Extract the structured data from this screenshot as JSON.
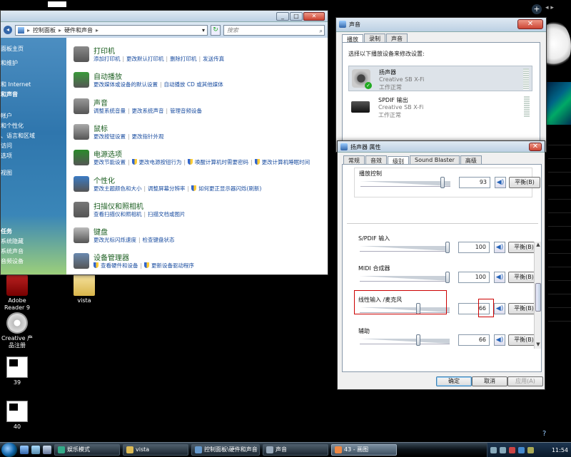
{
  "desktop": {
    "icons": [
      {
        "label": "Adobe Reader 9",
        "kind": "pdf"
      },
      {
        "label": "vista",
        "kind": "folder"
      },
      {
        "label": "Creative 产品注册",
        "kind": "cd"
      },
      {
        "label": "39",
        "kind": "thumb"
      },
      {
        "label": "40",
        "kind": "thumb"
      }
    ],
    "sidebar_feed": [
      "",
      "",
      "",
      "",
      ""
    ]
  },
  "control_panel": {
    "breadcrumb": [
      "控制面板",
      "硬件和声音"
    ],
    "search_placeholder": "搜索",
    "sidebar": [
      "面板主页",
      "和维护",
      "和 Internet",
      "和声音",
      "帐户",
      "和个性化",
      "、语言和区域",
      "访问",
      "选项",
      "视图",
      "任务",
      "系统隐藏",
      "系统声音",
      "音频设备"
    ],
    "categories": [
      {
        "title": "打印机",
        "links": [
          "添加打印机",
          "更改默认打印机",
          "删除打印机",
          "发送传真"
        ],
        "color": "#8a8a8a"
      },
      {
        "title": "自动播放",
        "links": [
          "更改媒体或设备的默认设置",
          "自动播放 CD 或其他媒体"
        ],
        "color": "#3a9a3a"
      },
      {
        "title": "声音",
        "links": [
          "调整系统音量",
          "更改系统声音",
          "管理音频设备"
        ],
        "color": "#999"
      },
      {
        "title": "鼠标",
        "links": [
          "更改按钮设置",
          "更改指针外观"
        ],
        "color": "#aaa"
      },
      {
        "title": "电源选项",
        "links": [
          "更改节能设置",
          "更改电源按钮行为",
          "唤醒计算机时需要密码",
          "更改计算机睡眠时间"
        ],
        "color": "#2a8a2a"
      },
      {
        "title": "个性化",
        "links": [
          "更改主题颜色和大小",
          "调整屏幕分辨率",
          "如何更正显示器闪烁(刷新)"
        ],
        "color": "#3b7bc4"
      },
      {
        "title": "扫描仪和照相机",
        "links": [
          "查看扫描仪和照相机",
          "扫描文档或图片"
        ],
        "color": "#777"
      },
      {
        "title": "键盘",
        "links": [
          "更改光标闪烁速度",
          "检查键盘状态"
        ],
        "color": "#bbb"
      },
      {
        "title": "设备管理器",
        "links": [
          "查看硬件和设备",
          "更新设备驱动程序"
        ],
        "color": "#6a8ab0"
      }
    ]
  },
  "sound_window": {
    "title": "声音",
    "tabs": [
      "播放",
      "录制",
      "声音"
    ],
    "prompt": "选择以下播放设备来修改设置:",
    "devices": [
      {
        "name": "扬声器",
        "sub": "Creative SB X-Fi",
        "status": "工作正常"
      },
      {
        "name": "SPDIF 输出",
        "sub": "Creative SB X-Fi",
        "status": "工作正常"
      }
    ]
  },
  "speaker_props": {
    "title": "扬声器 属性",
    "tabs": [
      "常规",
      "音效",
      "级别",
      "Sound Blaster",
      "高级"
    ],
    "balance_label": "平衡(B)",
    "rows": [
      {
        "label": "播放控制",
        "value": "93",
        "level": 93
      },
      {
        "label": "S/PDIF 输入",
        "value": "100",
        "level": 100
      },
      {
        "label": "MIDI 合成器",
        "value": "100",
        "level": 100
      },
      {
        "label": "线性输入  /麦克风",
        "value": "66",
        "level": 66
      },
      {
        "label": "辅助",
        "value": "66",
        "level": 66
      }
    ],
    "buttons": {
      "ok": "确定",
      "cancel": "取消",
      "apply": "应用(A)"
    }
  },
  "taskbar": {
    "buttons": [
      "娱乐模式",
      "vista",
      "控制面板\\硬件和声音",
      "声音",
      "43 - 画图"
    ],
    "clock": "11:54"
  }
}
